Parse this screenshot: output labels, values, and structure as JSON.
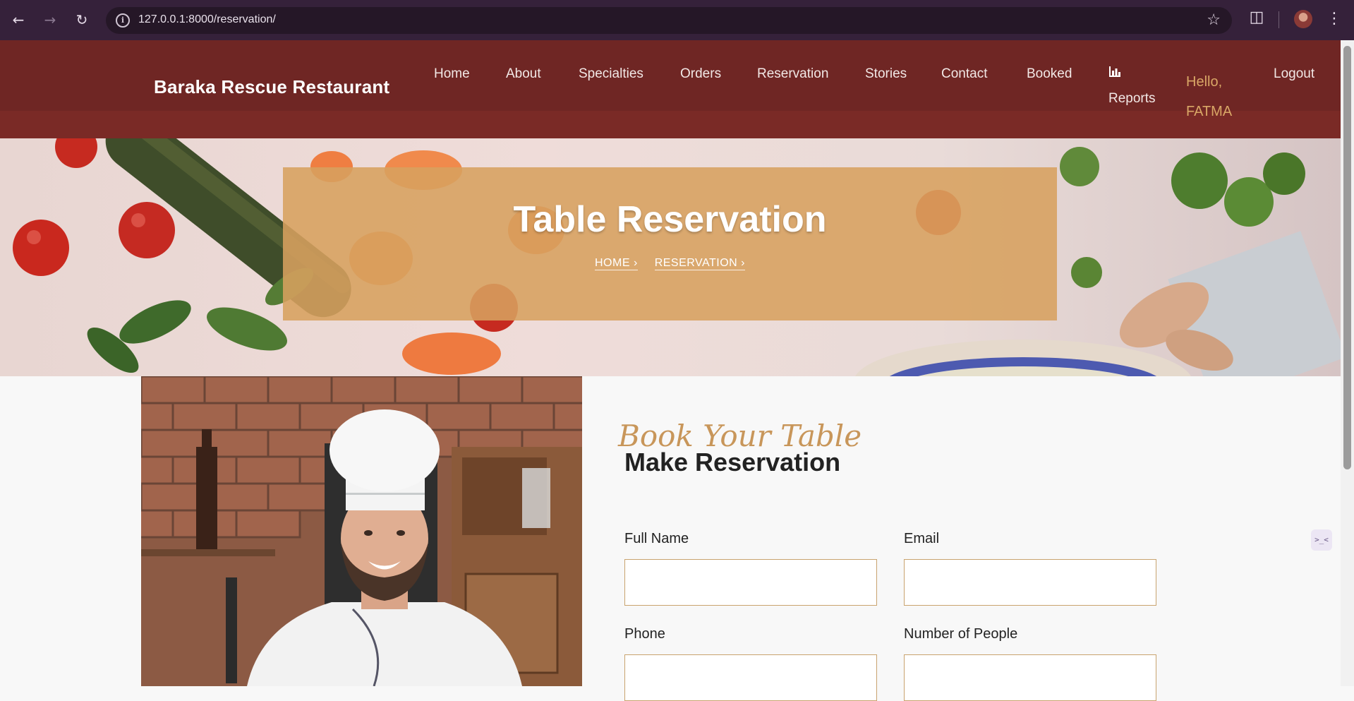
{
  "browser": {
    "url": "127.0.0.1:8000/reservation/",
    "icons": [
      "back-icon",
      "forward-icon",
      "reload-icon",
      "site-info-icon",
      "bookmark-star-icon",
      "extensions-icon",
      "profile-avatar",
      "kebab-menu-icon"
    ]
  },
  "header": {
    "brand": "Baraka Rescue Restaurant",
    "nav": {
      "home": "Home",
      "about": "About",
      "specialties": "Specialties",
      "orders": "Orders",
      "reservation": "Reservation",
      "stories": "Stories",
      "contact": "Contact",
      "booked": "Booked",
      "reports": "Reports",
      "hello": "Hello, FATMA",
      "logout": "Logout"
    }
  },
  "hero": {
    "title": "Table Reservation",
    "breadcrumb_home": "HOME",
    "breadcrumb_current": "RESERVATION"
  },
  "reservation": {
    "script_heading": "Book Your Table",
    "title": "Make Reservation",
    "labels": {
      "full_name": "Full Name",
      "email": "Email",
      "phone": "Phone",
      "people": "Number of People"
    }
  },
  "colors": {
    "header_bg": "#6f2624",
    "accent_gold": "#c8965a",
    "hero_box": "#d7a05f"
  }
}
